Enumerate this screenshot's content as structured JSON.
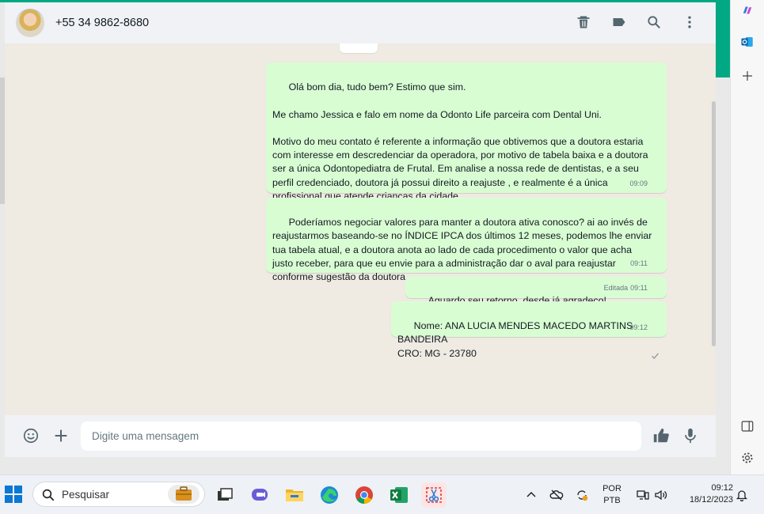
{
  "header": {
    "contact": "+55 34 9862-8680",
    "icons": [
      "trash-icon",
      "label-icon",
      "search-icon",
      "more-vert-icon"
    ]
  },
  "messages": [
    {
      "text": "Olá bom dia, tudo bem? Estimo que sim.\n\nMe chamo Jessica e falo em nome da Odonto Life parceira com Dental Uni.\n\nMotivo do meu contato é referente a informação que obtivemos que a doutora estaria\ncom interesse em descredenciar da operadora, por motivo de tabela baixa e a doutora\nser a única Odontopediatra de Frutal. Em analise a nossa rede de dentistas, e a seu\nperfil credenciado, doutora já possui direito a reajuste , e realmente é a única\nprofissional que atende crianças da cidade.",
      "time": "09:09",
      "status": "read"
    },
    {
      "text": "Poderíamos negociar valores para manter a doutora ativa conosco? ai ao invés de\nreajustarmos baseando-se no ÍNDICE IPCA dos últimos 12 meses, podemos lhe enviar\ntua tabela atual, e a doutora anota ao lado de cada procedimento o valor que acha\njusto receber, para que eu envie para a administração dar o aval para reajustar\nconforme sugestão da doutora.",
      "time": "09:11",
      "status": "read"
    },
    {
      "text": "Aguardo seu retorno, desde já agradeço!",
      "edited": "Editada",
      "time": "09:11",
      "status": "read"
    },
    {
      "text": "Nome: ANA LUCIA MENDES MACEDO MARTINS BANDEIRA\nCRO: MG - 23780",
      "time": "09:12",
      "status": "sent"
    }
  ],
  "composer": {
    "placeholder": "Digite uma mensagem"
  },
  "taskbar": {
    "search_label": "Pesquisar",
    "lang_line1": "POR",
    "lang_line2": "PTB",
    "time": "09:12",
    "date": "18/12/2023"
  },
  "colors": {
    "accent": "#00a884",
    "outgoing_bubble": "#d9fdd3",
    "chat_bg": "#efeae2",
    "read_tick": "#53bdeb"
  }
}
